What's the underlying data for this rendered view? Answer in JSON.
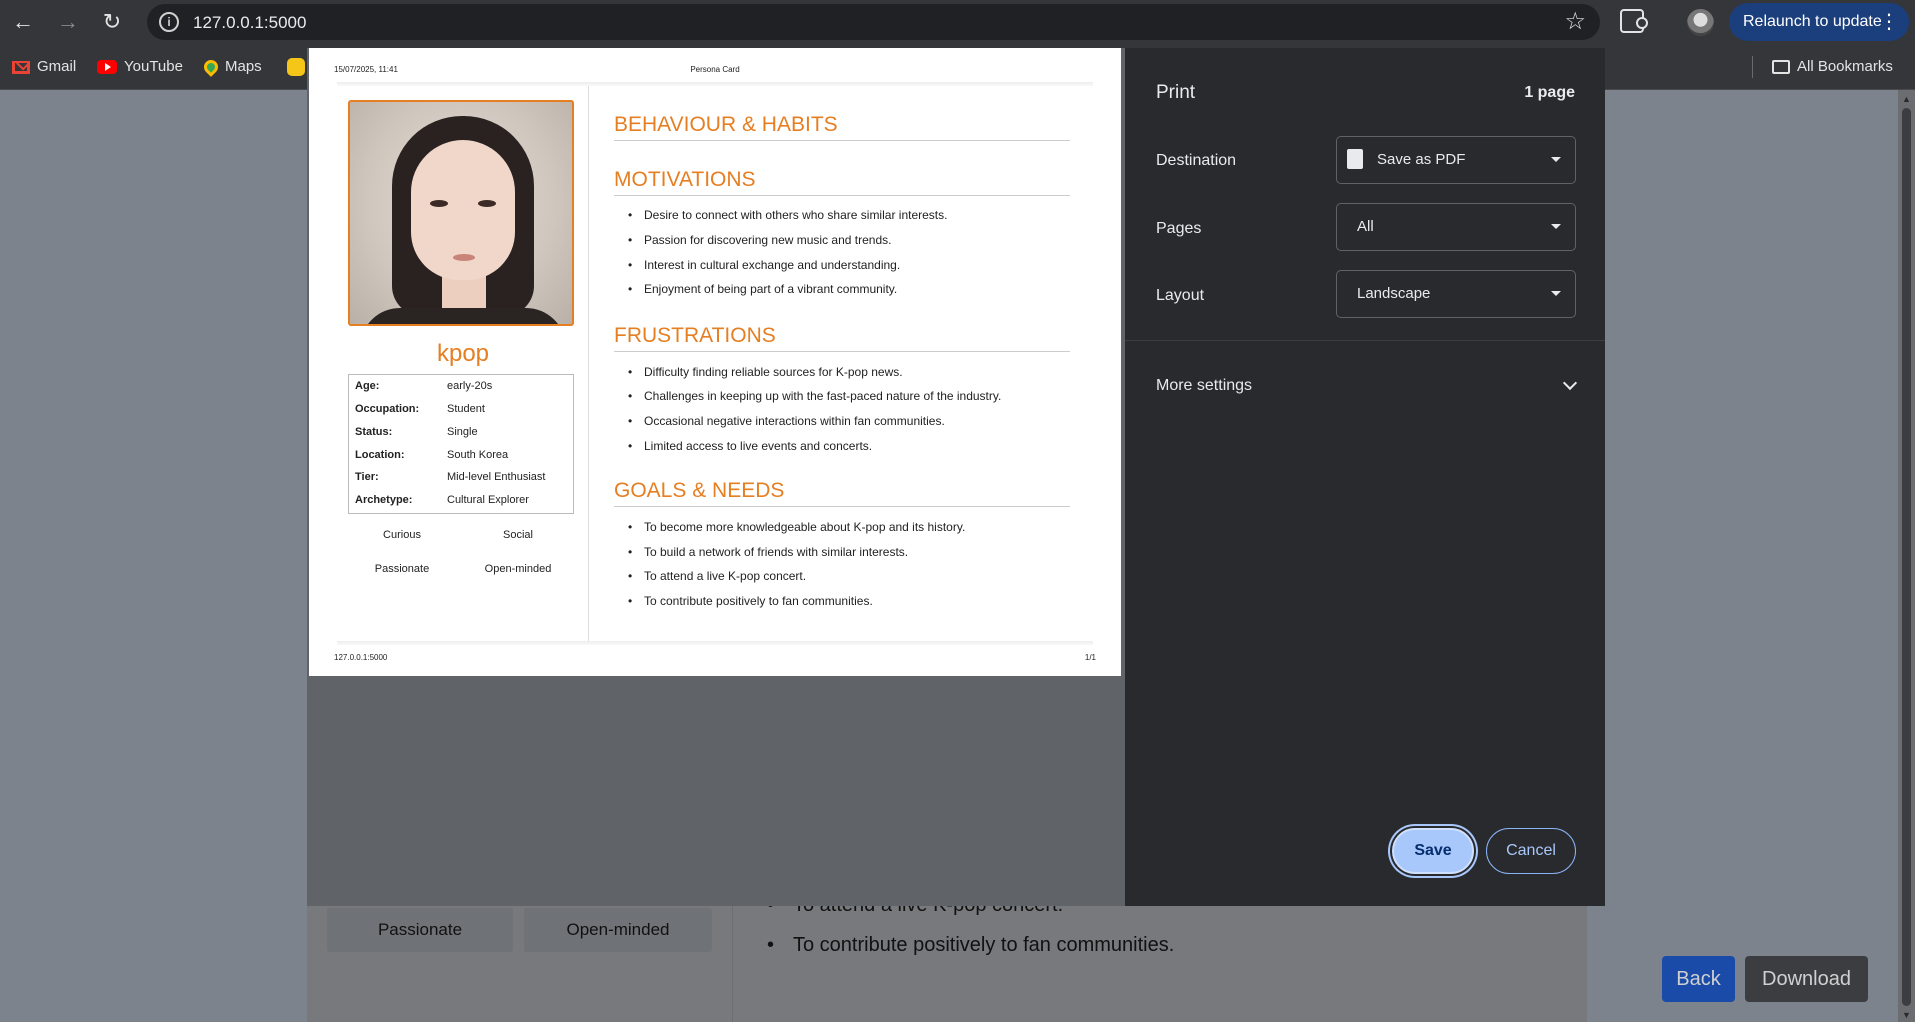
{
  "browser": {
    "url": "127.0.0.1:5000",
    "relaunch_label": "Relaunch to update",
    "bookmarks": [
      "Gmail",
      "YouTube",
      "Maps"
    ],
    "all_bookmarks_label": "All Bookmarks"
  },
  "print_dialog": {
    "title": "Print",
    "page_count": "1 page",
    "destination_label": "Destination",
    "destination_value": "Save as PDF",
    "pages_label": "Pages",
    "pages_value": "All",
    "layout_label": "Layout",
    "layout_value": "Landscape",
    "more_settings_label": "More settings",
    "save_label": "Save",
    "cancel_label": "Cancel"
  },
  "preview": {
    "header_datetime": "15/07/2025, 11:41",
    "header_title": "Persona Card",
    "footer_url": "127.0.0.1:5000",
    "footer_page": "1/1",
    "persona": {
      "name": "kpop",
      "details": [
        {
          "label": "Age:",
          "value": "early-20s"
        },
        {
          "label": "Occupation:",
          "value": "Student"
        },
        {
          "label": "Status:",
          "value": "Single"
        },
        {
          "label": "Location:",
          "value": "South Korea"
        },
        {
          "label": "Tier:",
          "value": "Mid-level Enthusiast"
        },
        {
          "label": "Archetype:",
          "value": "Cultural Explorer"
        }
      ],
      "traits": [
        "Curious",
        "Social",
        "Passionate",
        "Open-minded"
      ]
    },
    "sections": {
      "behaviour_title": "BEHAVIOUR & HABITS",
      "motivations_title": "MOTIVATIONS",
      "motivations": [
        "Desire to connect with others who share similar interests.",
        "Passion for discovering new music and trends.",
        "Interest in cultural exchange and understanding.",
        "Enjoyment of being part of a vibrant community."
      ],
      "frustrations_title": "FRUSTRATIONS",
      "frustrations": [
        "Difficulty finding reliable sources for K-pop news.",
        "Challenges in keeping up with the fast-paced nature of the industry.",
        "Occasional negative interactions within fan communities.",
        "Limited access to live events and concerts."
      ],
      "goals_title": "GOALS & NEEDS",
      "goals": [
        "To become more knowledgeable about K-pop and its history.",
        "To build a network of friends with similar interests.",
        "To attend a live K-pop concert.",
        "To contribute positively to fan communities."
      ]
    }
  },
  "background_page": {
    "traits_visible": [
      "Passionate",
      "Open-minded"
    ],
    "goals_visible": [
      "To attend a live K-pop concert.",
      "To contribute positively to fan communities."
    ],
    "back_label": "Back",
    "download_label": "Download",
    "colors": {
      "back": "#1a4ba8",
      "download": "#3c3d40"
    }
  }
}
